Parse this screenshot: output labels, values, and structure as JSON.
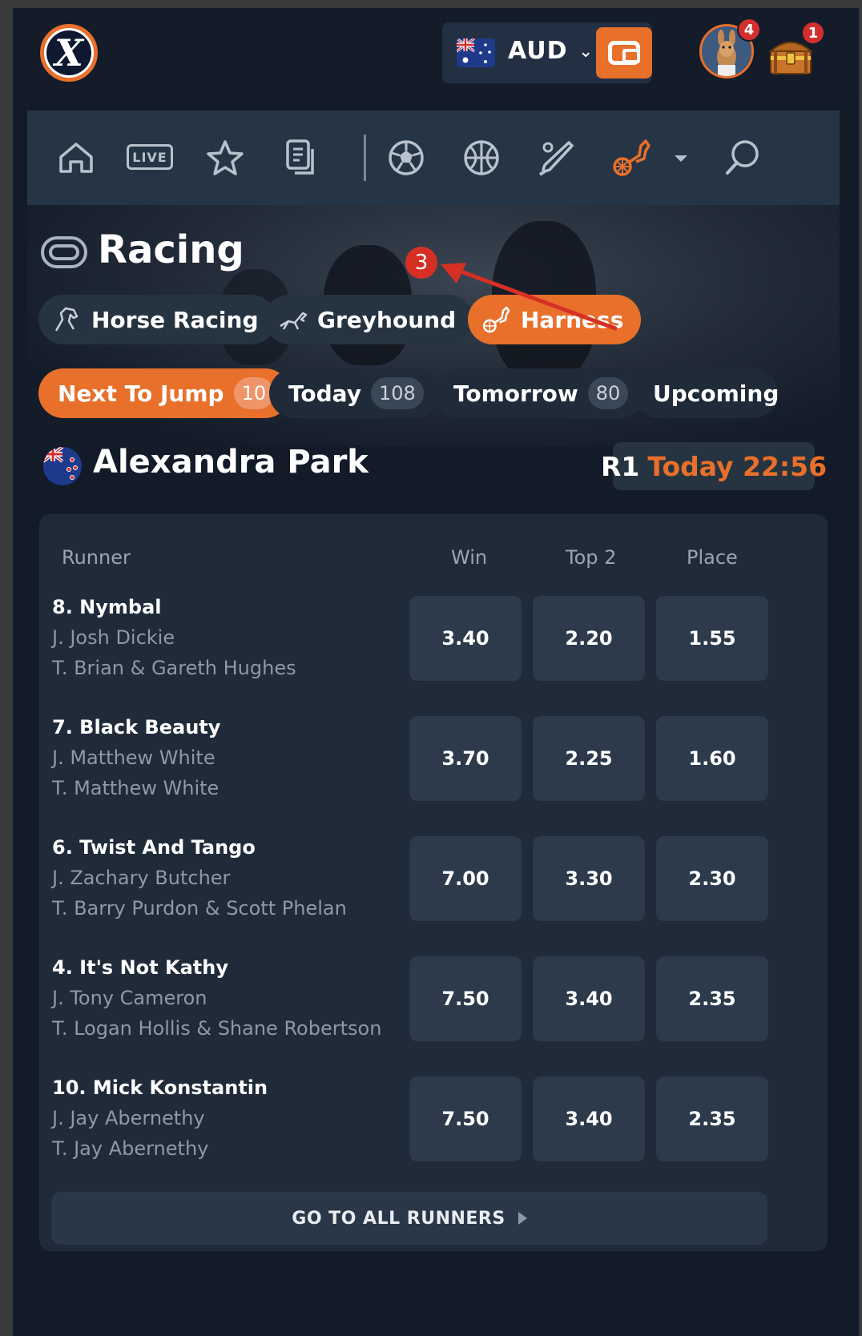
{
  "header": {
    "currency": "AUD",
    "avatar_badge": "4",
    "chest_badge": "1"
  },
  "nav": {
    "items": [
      "home-icon",
      "live-icon",
      "star-icon",
      "betslip-icon",
      "soccer-icon",
      "basketball-icon",
      "cricket-icon",
      "harness-icon",
      "chevron-down-icon",
      "search-icon"
    ],
    "live_label": "LIVE",
    "active_color": "#e8702b"
  },
  "racing": {
    "title": "Racing",
    "chips": [
      {
        "label": "Horse Racing"
      },
      {
        "label": "Greyhound"
      },
      {
        "label": "Harness"
      }
    ],
    "active_chip": "Harness",
    "tabs": [
      {
        "label": "Next To Jump",
        "count": "10"
      },
      {
        "label": "Today",
        "count": "108"
      },
      {
        "label": "Tomorrow",
        "count": "80"
      },
      {
        "label": "Upcoming",
        "count": ""
      }
    ]
  },
  "annotation": {
    "number": "3"
  },
  "meeting": {
    "name": "Alexandra Park",
    "race": "R1",
    "time": "Today 22:56"
  },
  "table": {
    "headers": [
      "Runner",
      "Win",
      "Top 2",
      "Place"
    ],
    "rows": [
      {
        "name": "8. Nymbal",
        "jockey": "J. Josh Dickie",
        "trainer": "T. Brian & Gareth Hughes",
        "win": "3.40",
        "top2": "2.20",
        "place": "1.55"
      },
      {
        "name": "7. Black Beauty",
        "jockey": "J. Matthew White",
        "trainer": "T. Matthew White",
        "win": "3.70",
        "top2": "2.25",
        "place": "1.60"
      },
      {
        "name": "6. Twist And Tango",
        "jockey": "J. Zachary Butcher",
        "trainer": "T. Barry Purdon & Scott Phelan",
        "win": "7.00",
        "top2": "3.30",
        "place": "2.30"
      },
      {
        "name": "4. It's Not Kathy",
        "jockey": "J. Tony Cameron",
        "trainer": "T. Logan Hollis & Shane Robertson",
        "win": "7.50",
        "top2": "3.40",
        "place": "2.35"
      },
      {
        "name": "10. Mick Konstantin",
        "jockey": "J. Jay Abernethy",
        "trainer": "T. Jay Abernethy",
        "win": "7.50",
        "top2": "3.40",
        "place": "2.35"
      }
    ],
    "go_all_label": "GO TO ALL RUNNERS"
  }
}
